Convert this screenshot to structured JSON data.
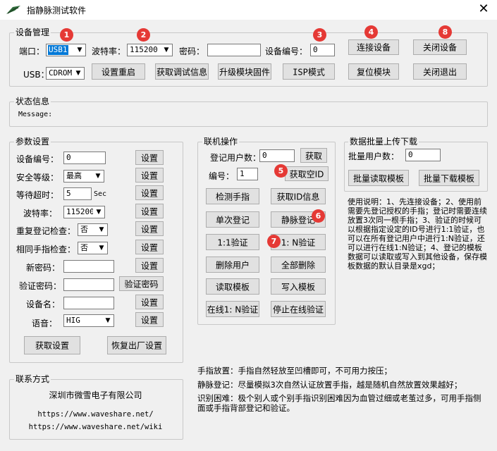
{
  "window": {
    "title": "指静脉测试软件",
    "close": "✕"
  },
  "device": {
    "legend": "设备管理",
    "port_label": "端口：",
    "port_value": "USB1",
    "baud_label": "波特率：",
    "baud_value": "115200",
    "password_label": "密码：",
    "password_value": "",
    "devno_label": "设备编号：",
    "devno_value": "0",
    "connect": "连接设备",
    "close_device": "关闭设备",
    "usb_label": "USB：",
    "usb_value": "CDROM",
    "reset_settings": "设置重启",
    "get_debug": "获取调试信息",
    "upgrade": "升级模块固件",
    "isp": "ISP模式",
    "reset_module": "复位模块",
    "close_exit": "关闭退出"
  },
  "status": {
    "legend": "状态信息",
    "message": "Message:"
  },
  "params": {
    "legend": "参数设置",
    "set": "设置",
    "devno_label": "设备编号：",
    "devno_value": "0",
    "security_label": "安全等级：",
    "security_value": "最高",
    "timeout_label": "等待超时：",
    "timeout_value": "5",
    "timeout_unit": "Sec",
    "baud_label": "波特率：",
    "baud_value": "115200",
    "dup_check_label": "重复登记检查：",
    "dup_check_value": "否",
    "same_finger_label": "相同手指检查：",
    "same_finger_value": "否",
    "new_pwd_label": "新密码：",
    "new_pwd_value": "",
    "verify_pwd_label": "验证密码：",
    "verify_pwd_value": "",
    "verify_pwd_btn": "验证密码",
    "devname_label": "设备名：",
    "devname_value": "",
    "voice_label": "语音：",
    "voice_value": "HIG",
    "get_settings": "获取设置",
    "factory_reset": "恢复出厂设置"
  },
  "online": {
    "legend": "联机操作",
    "users_label": "登记用户数：",
    "users_value": "0",
    "fetch": "获取",
    "id_label": "编号：",
    "id_value": "1",
    "get_empty_id": "获取空ID",
    "detect_finger": "检测手指",
    "get_id_info": "获取ID信息",
    "single_enroll": "单次登记",
    "vein_enroll": "静脉登记",
    "verify_1_1": "1:1验证",
    "verify_1_n": "1: N验证",
    "delete_user": "删除用户",
    "delete_all": "全部删除",
    "read_template": "读取模板",
    "write_template": "写入模板",
    "online_1_n": "在线1: N验证",
    "stop_online": "停止在线验证"
  },
  "batch": {
    "legend": "数据批量上传下载",
    "users_label": "批量用户数：",
    "users_value": "0",
    "read": "批量读取模板",
    "download": "批量下载模板"
  },
  "usage_text": "使用说明：1、先连接设备；2、使用前需要先登记授权的手指；登记时需要连续放置3次同一根手指；3、验证的时候可以根据指定设定的ID号进行1:1验证，也可以在所有登记用户中进行1:N验证，还可以进行在线1:N验证；4、登记的模板数据可以读取或写入到其他设备，保存模板数据的默认目录是xgd；",
  "tips": {
    "placement": "手指放置：手指自然轻放至凹槽即可，不可用力按压；",
    "enroll": "静脉登记：尽量模拟3次自然认证放置手指，越是随机自然放置效果越好；",
    "difficulty": "识别困难：极个别人或个别手指识别困难因为血管过细或老茧过多，可用手指侧面或手指背部登记和验证。"
  },
  "contact": {
    "legend": "联系方式",
    "company": "深圳市微雪电子有限公司",
    "url1": "https://www.waveshare.net/",
    "url2": "https://www.waveshare.net/wiki"
  },
  "badges": [
    "1",
    "2",
    "3",
    "4",
    "5",
    "6",
    "7",
    "8"
  ],
  "colors": {
    "badge": "#e53935",
    "selection": "#0078d7"
  }
}
